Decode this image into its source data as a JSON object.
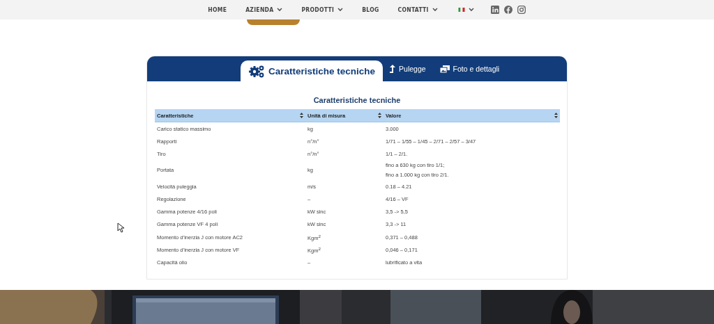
{
  "nav": {
    "items": [
      {
        "label": "HOME",
        "dropdown": false
      },
      {
        "label": "AZIENDA",
        "dropdown": true
      },
      {
        "label": "PRODOTTI",
        "dropdown": true
      },
      {
        "label": "BLOG",
        "dropdown": false
      },
      {
        "label": "CONTATTI",
        "dropdown": true
      }
    ]
  },
  "tabs": [
    {
      "label": "Caratteristiche tecniche",
      "selected": true
    },
    {
      "label": "Pulegge",
      "selected": false
    },
    {
      "label": "Foto e dettagli",
      "selected": false
    }
  ],
  "section_title": "Caratteristiche tecniche",
  "table": {
    "columns": [
      "Caratteristiche",
      "Unità di misura",
      "Valore"
    ],
    "rows": [
      [
        "Carico statico massimo",
        "kg",
        "3.000"
      ],
      [
        "Rapporti",
        "n°/n°",
        "1/71 – 1/55 – 1/45 – 2/71 – 2/57 – 3/47"
      ],
      [
        "Tiro",
        "n°/n°",
        "1/1 – 2/1."
      ],
      [
        "Portata",
        "kg",
        "fino a 630 kg con tiro 1/1;\nfino a 1.000 kg con tiro 2/1."
      ],
      [
        "Velocità puleggia",
        "m/s",
        "0.18 – 4.21"
      ],
      [
        "Regolazione",
        "–",
        "4/16 – VF"
      ],
      [
        "Gamma potenze 4/16 poli",
        "kW sinc",
        "3,5 -> 5,5"
      ],
      [
        "Gamma potenze VF 4 poli",
        "kW sinc",
        "3,3 -> 11"
      ],
      [
        "Momento d’inerzia J con motore AC2",
        "Kgm$^{2}$",
        "0,371 – 0,488"
      ],
      [
        "Momento d’inerzia J con motore VF",
        "Kgm$^{2}$",
        "0,046 – 0,171"
      ],
      [
        "Capacità olio",
        "–",
        "lubrificato a vita"
      ]
    ]
  }
}
